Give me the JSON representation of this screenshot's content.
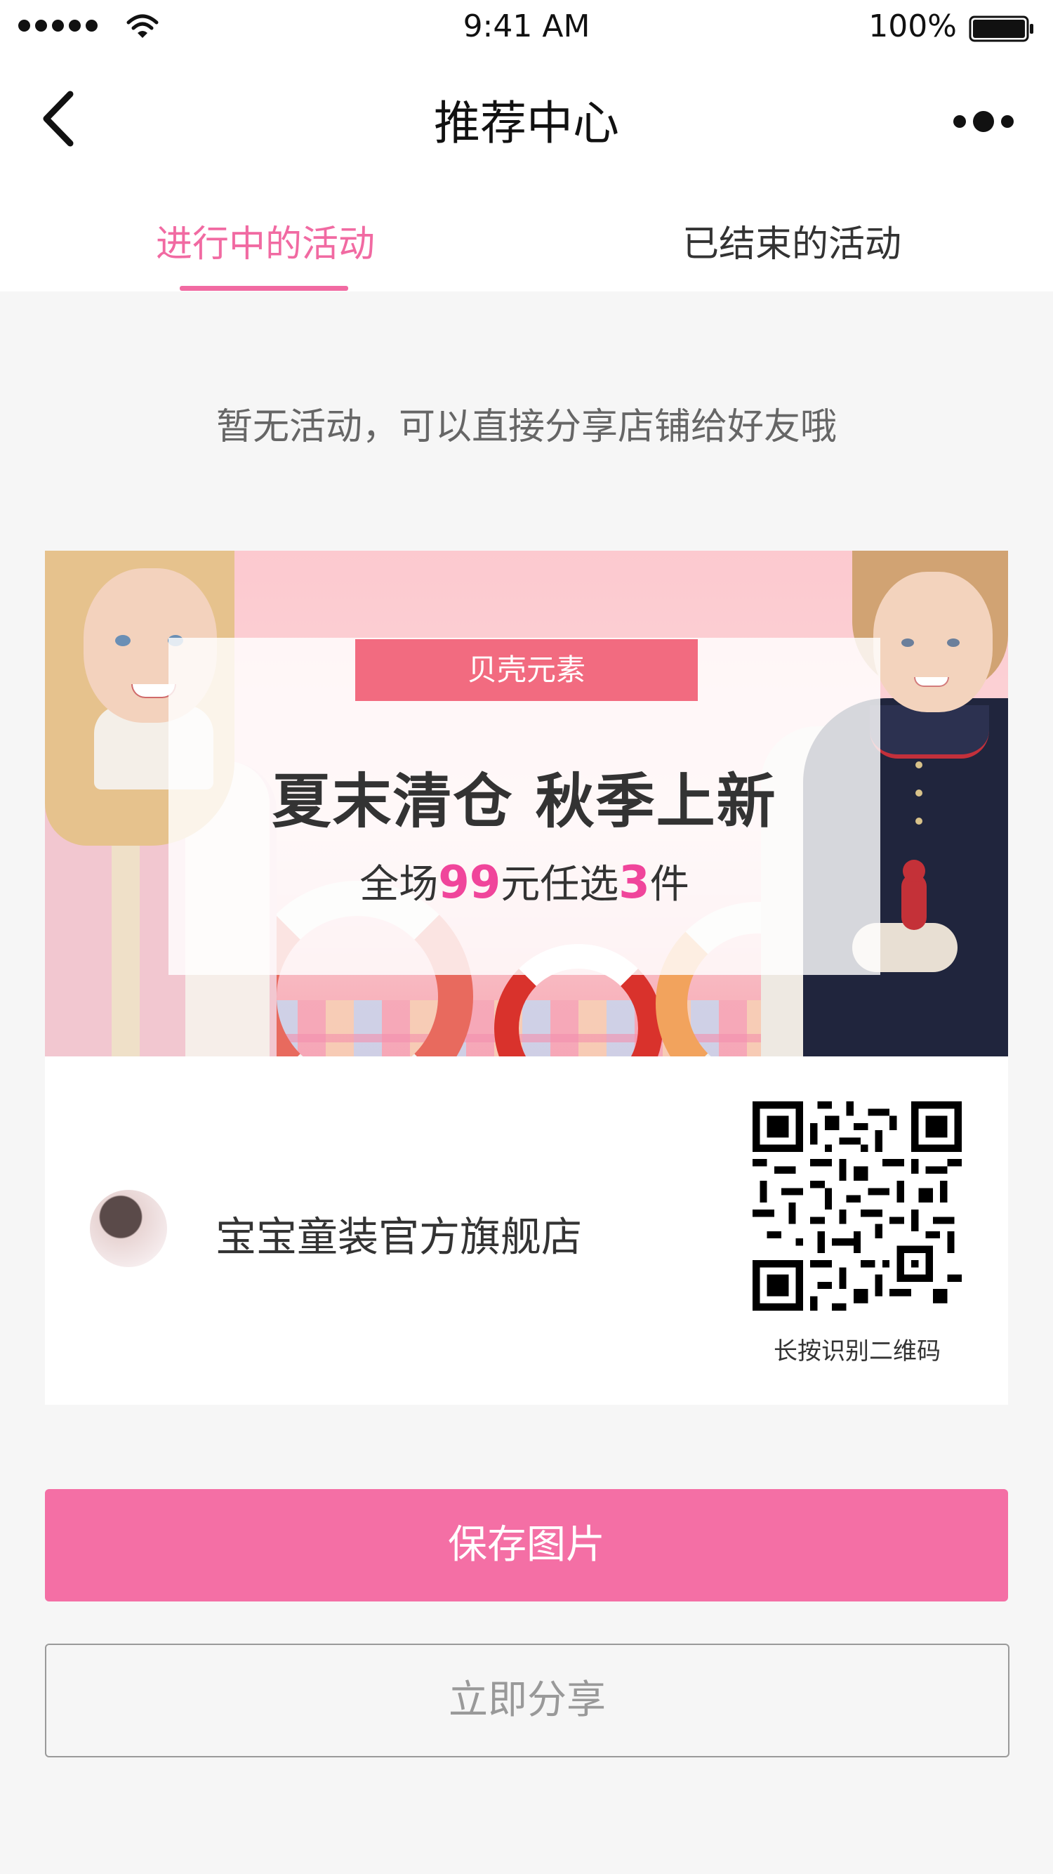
{
  "status_bar": {
    "time": "9:41 AM",
    "battery": "100%"
  },
  "nav": {
    "title": "推荐中心"
  },
  "tabs": [
    {
      "label": "进行中的活动",
      "active": true
    },
    {
      "label": "已结束的活动",
      "active": false
    }
  ],
  "empty_message": "暂无活动，可以直接分享店铺给好友哦",
  "poster": {
    "brand_tag": "贝壳元素",
    "headline": "夏末清仓 秋季上新",
    "promo": {
      "prefix": "全场",
      "price": "99",
      "middle": "元任选",
      "count": "3",
      "suffix": "件"
    },
    "shop_name": "宝宝童装官方旗舰店",
    "qr_caption": "长按识别二维码"
  },
  "actions": {
    "save_label": "保存图片",
    "share_label": "立即分享"
  },
  "colors": {
    "accent": "#f16aa2",
    "save_button": "#f46fa5",
    "brand_tag": "#f26b80",
    "promo_highlight": "#f0459b"
  }
}
